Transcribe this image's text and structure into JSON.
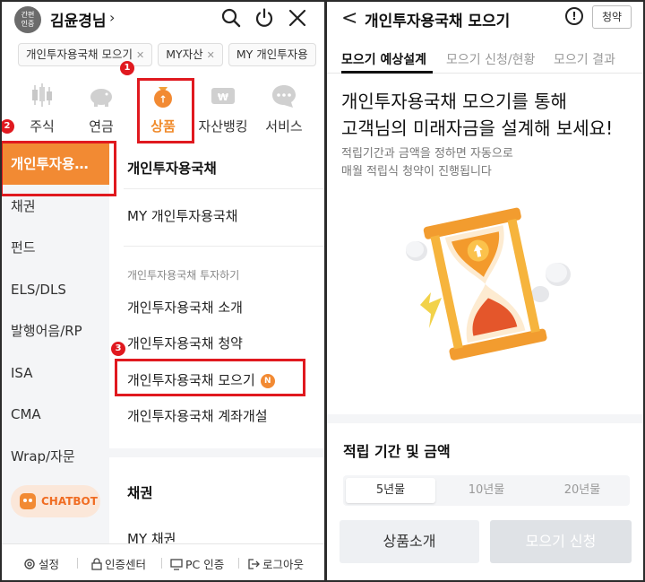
{
  "left": {
    "header": {
      "auth_badge": "간편\n인증",
      "auth_badge_line1": "간편",
      "auth_badge_line2": "인증",
      "username": "김윤경님",
      "chevron": "›",
      "icons": [
        "search-icon",
        "power-icon",
        "close-icon"
      ]
    },
    "chips": [
      {
        "label": "개인투자용국채 모으기"
      },
      {
        "label": "MY자산"
      },
      {
        "label": "MY 개인투자용"
      }
    ],
    "categories": [
      {
        "label": "주식",
        "icon": "candlestick-icon"
      },
      {
        "label": "연금",
        "icon": "piggybank-icon"
      },
      {
        "label": "상품",
        "icon": "money-bag-icon",
        "active": true
      },
      {
        "label": "자산뱅킹",
        "icon": "won-card-icon"
      },
      {
        "label": "서비스",
        "icon": "chat-bubble-icon"
      }
    ],
    "sidebar": {
      "items": [
        {
          "label": "개인투자용…",
          "active": true
        },
        {
          "label": "채권"
        },
        {
          "label": "펀드"
        },
        {
          "label": "ELS/DLS"
        },
        {
          "label": "발행어음/RP"
        },
        {
          "label": "ISA"
        },
        {
          "label": "CMA"
        },
        {
          "label": "Wrap/자문"
        }
      ],
      "chatbot": "CHATBOT"
    },
    "content": {
      "section1_title": "개인투자용국채",
      "my_item": "MY 개인투자용국채",
      "invest_header": "개인투자용국채 투자하기",
      "items": [
        {
          "label": "개인투자용국채 소개"
        },
        {
          "label": "개인투자용국채 청약"
        },
        {
          "label": "개인투자용국채 모으기",
          "badge": "N"
        },
        {
          "label": "개인투자용국채 계좌개설"
        }
      ],
      "section2_title": "채권",
      "section2_item": "MY 채권"
    },
    "bottom_bar": [
      {
        "label": "설정",
        "icon": "gear-icon"
      },
      {
        "label": "인증센터",
        "icon": "lock-icon"
      },
      {
        "label": "PC 인증",
        "icon": "monitor-icon"
      },
      {
        "label": "로그아웃",
        "icon": "logout-icon"
      }
    ],
    "annotations": [
      "1",
      "2",
      "3"
    ],
    "colors": {
      "accent": "#f28a33",
      "annotation": "#e0191f"
    }
  },
  "right": {
    "header": {
      "back": "<",
      "title": "개인투자용국채 모으기",
      "info": "!",
      "subscribe_button": "청약"
    },
    "tabs": [
      {
        "label": "모으기 예상설계",
        "active": true
      },
      {
        "label": "모으기 신청/현황"
      },
      {
        "label": "모으기 결과"
      }
    ],
    "headline_line1": "개인투자용국채 모으기를 통해",
    "headline_line2": "고객님의 미래자금을 설계해 보세요!",
    "desc_line1": "적립기간과 금액을 정하면 자동으로",
    "desc_line2": "매월 적립식 청약이 진행됩니다",
    "illustration": "hourglass-icon",
    "period_title": "적립 기간 및 금액",
    "periods": [
      {
        "label": "5년물",
        "active": true
      },
      {
        "label": "10년물"
      },
      {
        "label": "20년물"
      }
    ],
    "buttons": {
      "intro": "상품소개",
      "apply": "모으기 신청"
    }
  }
}
